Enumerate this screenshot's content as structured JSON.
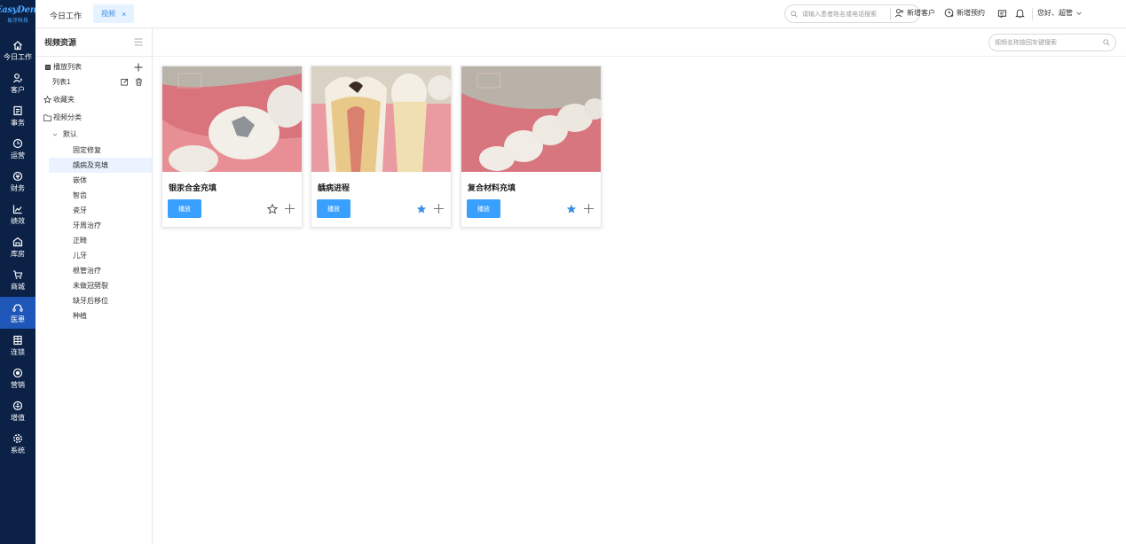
{
  "brand": {
    "logo": "EasyDent",
    "subtitle": "易牙科技"
  },
  "nav": {
    "items": [
      {
        "label": "今日工作",
        "icon": "home-icon"
      },
      {
        "label": "客户",
        "icon": "user-icon"
      },
      {
        "label": "事务",
        "icon": "task-icon"
      },
      {
        "label": "运营",
        "icon": "clock-icon"
      },
      {
        "label": "财务",
        "icon": "finance-icon"
      },
      {
        "label": "绩效",
        "icon": "chart-icon"
      },
      {
        "label": "库房",
        "icon": "warehouse-icon"
      },
      {
        "label": "商城",
        "icon": "cart-icon"
      },
      {
        "label": "医患",
        "icon": "doctor-patient-icon"
      },
      {
        "label": "连锁",
        "icon": "chain-icon"
      },
      {
        "label": "营销",
        "icon": "marketing-icon"
      },
      {
        "label": "增值",
        "icon": "value-added-icon"
      },
      {
        "label": "系统",
        "icon": "gear-icon"
      }
    ],
    "active_label": "医患"
  },
  "topbar": {
    "tab_today": "今日工作",
    "tab_video": "视频",
    "tab_close": "×",
    "search_placeholder": "请输入患者姓名或电话搜索",
    "new_customer": "新增客户",
    "new_appointment": "新增预约",
    "greeting": "您好、超管"
  },
  "sidebar": {
    "title": "视频资源",
    "playlist_header": "播放列表",
    "playlist_item": "列表1",
    "favorites": "收藏夹",
    "categories_header": "视频分类",
    "default_group": "默认",
    "categories": [
      "固定修复",
      "龋病及充填",
      "嵌体",
      "智齿",
      "瓷牙",
      "牙周治疗",
      "正畸",
      "儿牙",
      "根管治疗",
      "未做冠劈裂",
      "缺牙后移位",
      "种植"
    ],
    "selected_category": "龋病及充填"
  },
  "main": {
    "search_placeholder": "视频名称按回车键搜索",
    "videos": [
      {
        "title": "银汞合金充填",
        "play_label": "播放",
        "favorited": false
      },
      {
        "title": "龋病进程",
        "play_label": "播放",
        "favorited": true
      },
      {
        "title": "复合材料充填",
        "play_label": "播放",
        "favorited": true
      }
    ]
  },
  "colors": {
    "nav_bg": "#0b2146",
    "nav_active": "#1f57b8",
    "accent": "#3aa0ff",
    "selected_bg": "#eaf3ff",
    "star_filled": "#3a8ee6"
  }
}
